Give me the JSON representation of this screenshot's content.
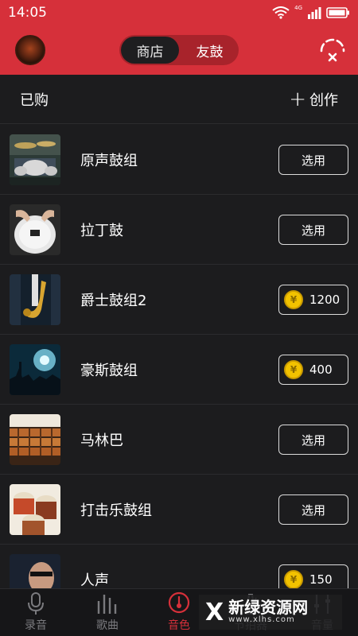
{
  "status_bar": {
    "time": "14:05",
    "network_label": "4G"
  },
  "header": {
    "tabs": [
      {
        "label": "商店",
        "active": true
      },
      {
        "label": "友鼓",
        "active": false
      }
    ]
  },
  "subheader": {
    "title": "已购",
    "create_label": "创作"
  },
  "items": [
    {
      "name": "原声鼓组",
      "action": "选用"
    },
    {
      "name": "拉丁鼓",
      "action": "选用"
    },
    {
      "name": "爵士鼓组2",
      "price": "1200"
    },
    {
      "name": "豪斯鼓组",
      "price": "400"
    },
    {
      "name": "马林巴",
      "action": "选用"
    },
    {
      "name": "打击乐鼓组",
      "action": "选用"
    },
    {
      "name": "人声",
      "price": "150"
    }
  ],
  "tabbar": {
    "tabs": [
      {
        "label": "录音",
        "icon": "mic-icon"
      },
      {
        "label": "歌曲",
        "icon": "bars-icon"
      },
      {
        "label": "音色",
        "icon": "timbre-icon",
        "active": true
      },
      {
        "label": "节拍器",
        "icon": "metronome-icon"
      },
      {
        "label": "音量",
        "icon": "volume-icon"
      }
    ]
  },
  "watermark": {
    "logo": "X",
    "title": "新绿资源网",
    "url": "www.xlhs.com"
  },
  "colors": {
    "brand_red": "#d6303a",
    "background": "#1c1c1e",
    "coin_gold": "#f2c200"
  }
}
